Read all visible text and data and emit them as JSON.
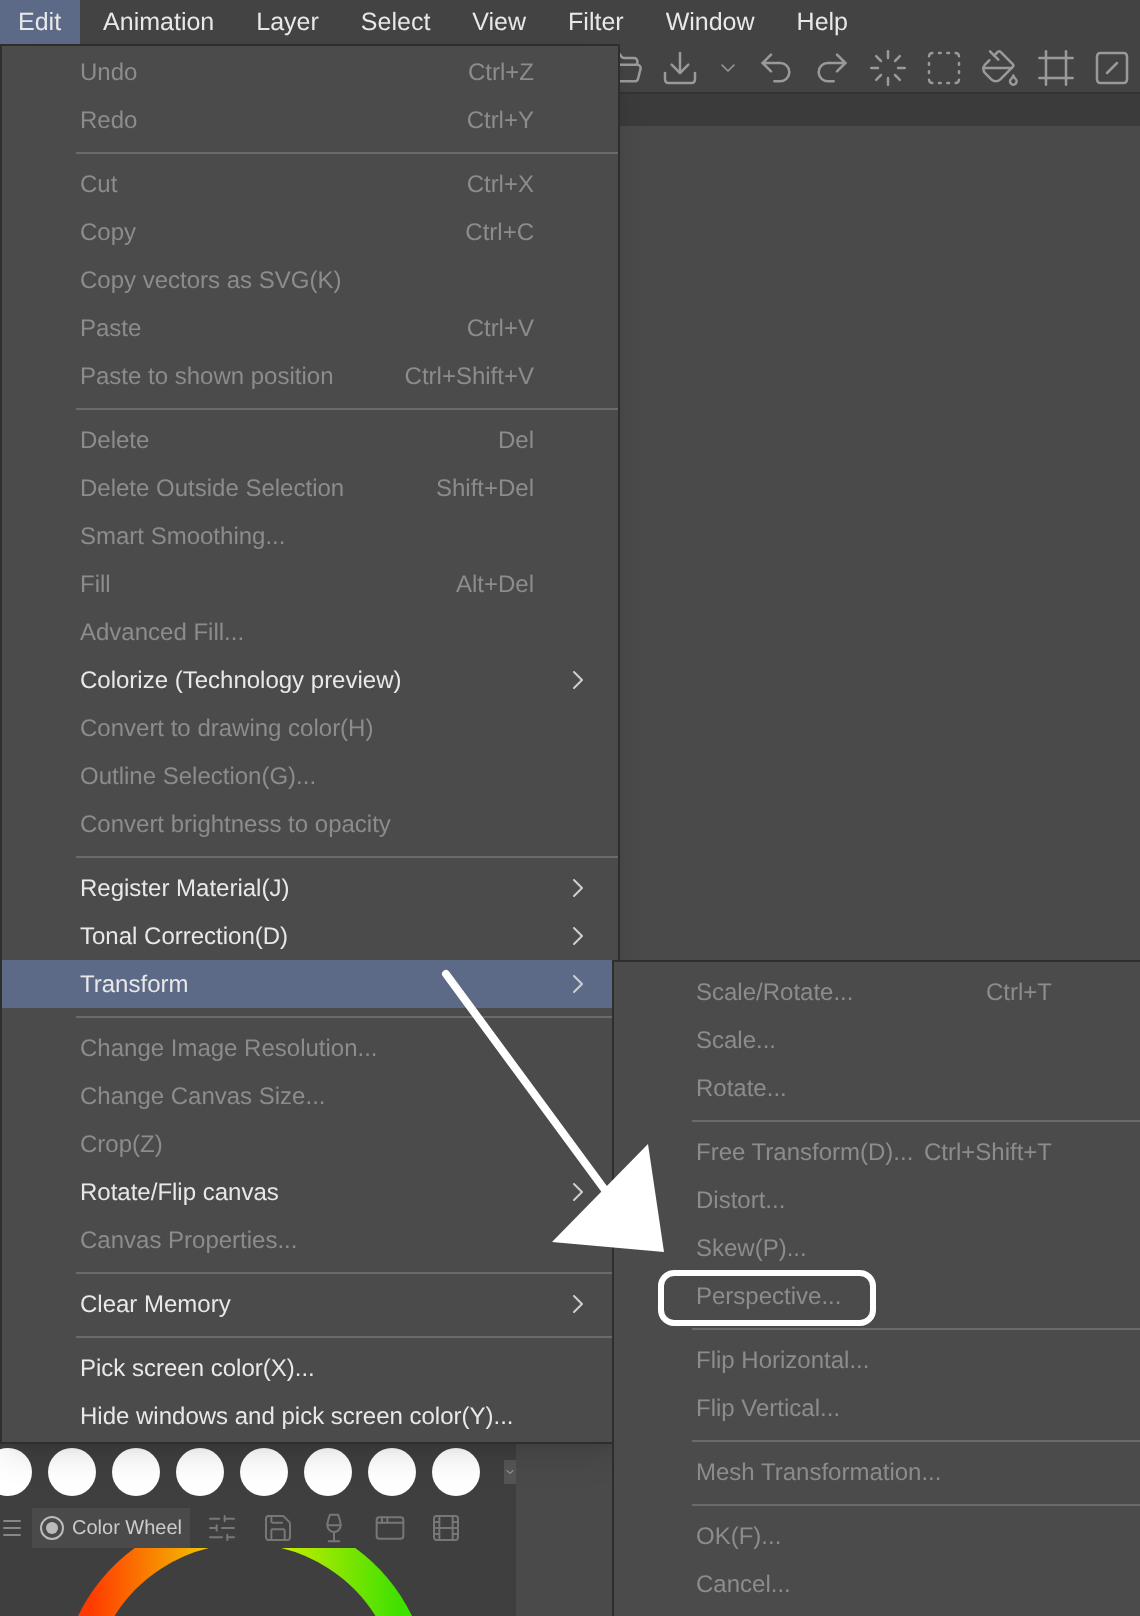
{
  "menubar": [
    {
      "label": "Edit",
      "selected": true
    },
    {
      "label": "Animation",
      "selected": false
    },
    {
      "label": "Layer",
      "selected": false
    },
    {
      "label": "Select",
      "selected": false
    },
    {
      "label": "View",
      "selected": false
    },
    {
      "label": "Filter",
      "selected": false
    },
    {
      "label": "Window",
      "selected": false
    },
    {
      "label": "Help",
      "selected": false
    }
  ],
  "edit_menu": [
    {
      "kind": "item",
      "label": "Undo",
      "shortcut": "Ctrl+Z",
      "disabled": true,
      "submenu": false,
      "selected": false
    },
    {
      "kind": "item",
      "label": "Redo",
      "shortcut": "Ctrl+Y",
      "disabled": true,
      "submenu": false,
      "selected": false
    },
    {
      "kind": "separator"
    },
    {
      "kind": "item",
      "label": "Cut",
      "shortcut": "Ctrl+X",
      "disabled": true,
      "submenu": false,
      "selected": false
    },
    {
      "kind": "item",
      "label": "Copy",
      "shortcut": "Ctrl+C",
      "disabled": true,
      "submenu": false,
      "selected": false
    },
    {
      "kind": "item",
      "label": "Copy vectors as SVG(K)",
      "disabled": true,
      "submenu": false,
      "selected": false
    },
    {
      "kind": "item",
      "label": "Paste",
      "shortcut": "Ctrl+V",
      "disabled": true,
      "submenu": false,
      "selected": false
    },
    {
      "kind": "item",
      "label": "Paste to shown position",
      "shortcut": "Ctrl+Shift+V",
      "disabled": true,
      "submenu": false,
      "selected": false
    },
    {
      "kind": "separator"
    },
    {
      "kind": "item",
      "label": "Delete",
      "shortcut": "Del",
      "disabled": true,
      "submenu": false,
      "selected": false
    },
    {
      "kind": "item",
      "label": "Delete Outside Selection",
      "shortcut": "Shift+Del",
      "disabled": true,
      "submenu": false,
      "selected": false
    },
    {
      "kind": "item",
      "label": "Smart Smoothing...",
      "disabled": true,
      "submenu": false,
      "selected": false
    },
    {
      "kind": "item",
      "label": "Fill",
      "shortcut": "Alt+Del",
      "disabled": true,
      "submenu": false,
      "selected": false
    },
    {
      "kind": "item",
      "label": "Advanced Fill...",
      "disabled": true,
      "submenu": false,
      "selected": false
    },
    {
      "kind": "item",
      "label": "Colorize (Technology preview)",
      "disabled": false,
      "submenu": true,
      "selected": false
    },
    {
      "kind": "item",
      "label": "Convert to drawing color(H)",
      "disabled": true,
      "submenu": false,
      "selected": false
    },
    {
      "kind": "item",
      "label": "Outline Selection(G)...",
      "disabled": true,
      "submenu": false,
      "selected": false
    },
    {
      "kind": "item",
      "label": "Convert brightness to opacity",
      "disabled": true,
      "submenu": false,
      "selected": false
    },
    {
      "kind": "separator"
    },
    {
      "kind": "item",
      "label": "Register Material(J)",
      "disabled": false,
      "submenu": true,
      "selected": false
    },
    {
      "kind": "item",
      "label": "Tonal Correction(D)",
      "disabled": false,
      "submenu": true,
      "selected": false
    },
    {
      "kind": "item",
      "label": "Transform",
      "disabled": false,
      "submenu": true,
      "selected": true
    },
    {
      "kind": "separator"
    },
    {
      "kind": "item",
      "label": "Change Image Resolution...",
      "disabled": true,
      "submenu": false,
      "selected": false
    },
    {
      "kind": "item",
      "label": "Change Canvas Size...",
      "disabled": true,
      "submenu": false,
      "selected": false
    },
    {
      "kind": "item",
      "label": "Crop(Z)",
      "disabled": true,
      "submenu": false,
      "selected": false
    },
    {
      "kind": "item",
      "label": "Rotate/Flip canvas",
      "disabled": false,
      "submenu": true,
      "selected": false
    },
    {
      "kind": "item",
      "label": "Canvas Properties...",
      "disabled": true,
      "submenu": false,
      "selected": false
    },
    {
      "kind": "separator"
    },
    {
      "kind": "item",
      "label": "Clear Memory",
      "disabled": false,
      "submenu": true,
      "selected": false
    },
    {
      "kind": "separator"
    },
    {
      "kind": "item",
      "label": "Pick screen color(X)...",
      "disabled": false,
      "submenu": false,
      "selected": false
    },
    {
      "kind": "item",
      "label": "Hide windows and pick screen color(Y)...",
      "disabled": false,
      "submenu": false,
      "selected": false
    }
  ],
  "transform_menu": [
    {
      "kind": "item",
      "label": "Scale/Rotate...",
      "shortcut": "Ctrl+T",
      "disabled": true
    },
    {
      "kind": "item",
      "label": "Scale...",
      "disabled": true
    },
    {
      "kind": "item",
      "label": "Rotate...",
      "disabled": true
    },
    {
      "kind": "separator"
    },
    {
      "kind": "item",
      "label": "Free Transform(D)...",
      "shortcut": "Ctrl+Shift+T",
      "disabled": true
    },
    {
      "kind": "item",
      "label": "Distort...",
      "disabled": true
    },
    {
      "kind": "item",
      "label": "Skew(P)...",
      "disabled": true
    },
    {
      "kind": "item",
      "label": "Perspective...",
      "disabled": true
    },
    {
      "kind": "separator"
    },
    {
      "kind": "item",
      "label": "Flip Horizontal...",
      "disabled": true
    },
    {
      "kind": "item",
      "label": "Flip Vertical...",
      "disabled": true
    },
    {
      "kind": "separator"
    },
    {
      "kind": "item",
      "label": "Mesh Transformation...",
      "disabled": true
    },
    {
      "kind": "separator"
    },
    {
      "kind": "item",
      "label": "OK(F)...",
      "disabled": true
    },
    {
      "kind": "item",
      "label": "Cancel...",
      "disabled": true
    }
  ],
  "color_panel": {
    "tab_label": "Color Wheel"
  }
}
